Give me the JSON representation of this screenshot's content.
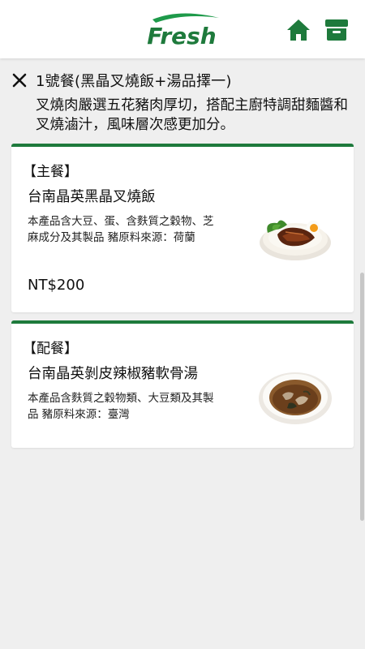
{
  "header": {
    "logo_text": "Fresh",
    "home_icon": "home-icon",
    "box_icon": "archive-box-icon",
    "brand_color": "#1e7a3c"
  },
  "meal": {
    "title": "1號餐(黑晶叉燒飯+湯品擇一)",
    "description": "叉燒肉嚴選五花豬肉厚切，搭配主廚特調甜麵醬和叉燒滷汁，風味層次感更加分。"
  },
  "items": [
    {
      "section": "【主餐】",
      "name": "台南晶英黑晶叉燒飯",
      "description": "本產品含大豆、蛋、含麩質之穀物、芝麻成分及其製品 豬原料來源：荷蘭",
      "price": "NT$200"
    },
    {
      "section": "【配餐】",
      "name": "台南晶英剝皮辣椒豬軟骨湯",
      "description": "本產品含麩質之穀物類、大豆類及其製品 豬原料來源：臺灣"
    }
  ]
}
